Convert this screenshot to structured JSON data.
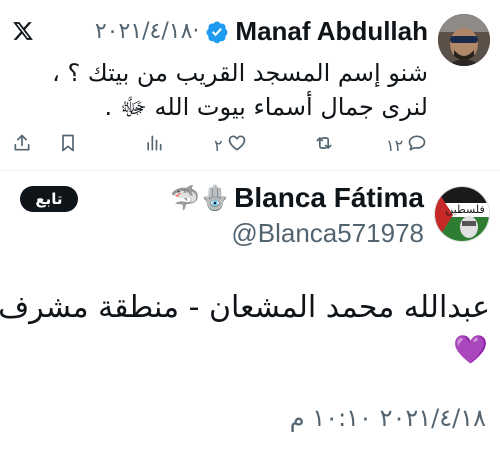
{
  "quoted_tweet": {
    "author_name": "Manaf Abdullah",
    "date": "٢٠٢١/٤/١٨",
    "separator": "·",
    "text": "شنو إسم المسجد القريب من بيتك ؟ ، لنرى جمال أسماء بيوت الله ﷻ .",
    "replies": "١٢",
    "likes": "٢",
    "icons": {
      "logo": "x-logo-icon",
      "verified": "verified-badge-icon",
      "reply": "reply-icon",
      "retweet": "retweet-icon",
      "like": "heart-outline-icon",
      "views": "views-chart-icon",
      "bookmark": "bookmark-icon",
      "share": "share-icon"
    }
  },
  "reply_tweet": {
    "follow_label": "تابع",
    "display_name": "Blanca Fátima",
    "name_emojis": "🪬🦈",
    "handle": "@Blanca571978",
    "text": "عبدالله محمد المشعان - منطقة مشرف",
    "heart_emoji": "💜",
    "timestamp": "٢٠٢١/٤/١٨ ١٠:١٠ م"
  },
  "colors": {
    "text": "#0f1419",
    "secondary": "#536471",
    "verified_blue": "#1d9bf0",
    "follow_button_bg": "#0f1419"
  }
}
